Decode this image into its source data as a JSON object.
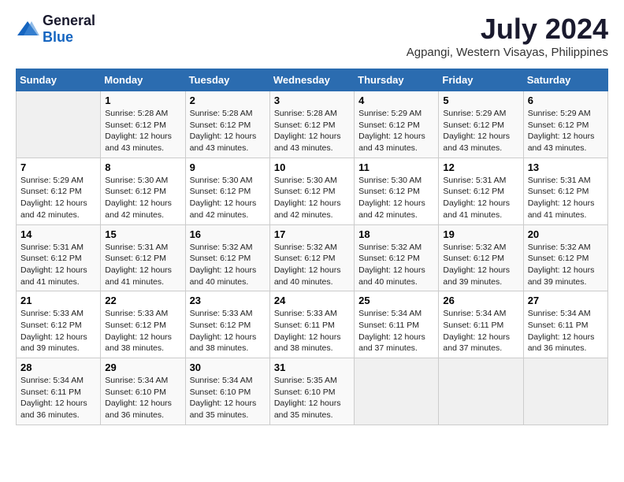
{
  "logo": {
    "general": "General",
    "blue": "Blue"
  },
  "title": "July 2024",
  "subtitle": "Agpangi, Western Visayas, Philippines",
  "days_header": [
    "Sunday",
    "Monday",
    "Tuesday",
    "Wednesday",
    "Thursday",
    "Friday",
    "Saturday"
  ],
  "weeks": [
    [
      {
        "num": "",
        "info": ""
      },
      {
        "num": "1",
        "info": "Sunrise: 5:28 AM\nSunset: 6:12 PM\nDaylight: 12 hours\nand 43 minutes."
      },
      {
        "num": "2",
        "info": "Sunrise: 5:28 AM\nSunset: 6:12 PM\nDaylight: 12 hours\nand 43 minutes."
      },
      {
        "num": "3",
        "info": "Sunrise: 5:28 AM\nSunset: 6:12 PM\nDaylight: 12 hours\nand 43 minutes."
      },
      {
        "num": "4",
        "info": "Sunrise: 5:29 AM\nSunset: 6:12 PM\nDaylight: 12 hours\nand 43 minutes."
      },
      {
        "num": "5",
        "info": "Sunrise: 5:29 AM\nSunset: 6:12 PM\nDaylight: 12 hours\nand 43 minutes."
      },
      {
        "num": "6",
        "info": "Sunrise: 5:29 AM\nSunset: 6:12 PM\nDaylight: 12 hours\nand 43 minutes."
      }
    ],
    [
      {
        "num": "7",
        "info": "Sunrise: 5:29 AM\nSunset: 6:12 PM\nDaylight: 12 hours\nand 42 minutes."
      },
      {
        "num": "8",
        "info": "Sunrise: 5:30 AM\nSunset: 6:12 PM\nDaylight: 12 hours\nand 42 minutes."
      },
      {
        "num": "9",
        "info": "Sunrise: 5:30 AM\nSunset: 6:12 PM\nDaylight: 12 hours\nand 42 minutes."
      },
      {
        "num": "10",
        "info": "Sunrise: 5:30 AM\nSunset: 6:12 PM\nDaylight: 12 hours\nand 42 minutes."
      },
      {
        "num": "11",
        "info": "Sunrise: 5:30 AM\nSunset: 6:12 PM\nDaylight: 12 hours\nand 42 minutes."
      },
      {
        "num": "12",
        "info": "Sunrise: 5:31 AM\nSunset: 6:12 PM\nDaylight: 12 hours\nand 41 minutes."
      },
      {
        "num": "13",
        "info": "Sunrise: 5:31 AM\nSunset: 6:12 PM\nDaylight: 12 hours\nand 41 minutes."
      }
    ],
    [
      {
        "num": "14",
        "info": "Sunrise: 5:31 AM\nSunset: 6:12 PM\nDaylight: 12 hours\nand 41 minutes."
      },
      {
        "num": "15",
        "info": "Sunrise: 5:31 AM\nSunset: 6:12 PM\nDaylight: 12 hours\nand 41 minutes."
      },
      {
        "num": "16",
        "info": "Sunrise: 5:32 AM\nSunset: 6:12 PM\nDaylight: 12 hours\nand 40 minutes."
      },
      {
        "num": "17",
        "info": "Sunrise: 5:32 AM\nSunset: 6:12 PM\nDaylight: 12 hours\nand 40 minutes."
      },
      {
        "num": "18",
        "info": "Sunrise: 5:32 AM\nSunset: 6:12 PM\nDaylight: 12 hours\nand 40 minutes."
      },
      {
        "num": "19",
        "info": "Sunrise: 5:32 AM\nSunset: 6:12 PM\nDaylight: 12 hours\nand 39 minutes."
      },
      {
        "num": "20",
        "info": "Sunrise: 5:32 AM\nSunset: 6:12 PM\nDaylight: 12 hours\nand 39 minutes."
      }
    ],
    [
      {
        "num": "21",
        "info": "Sunrise: 5:33 AM\nSunset: 6:12 PM\nDaylight: 12 hours\nand 39 minutes."
      },
      {
        "num": "22",
        "info": "Sunrise: 5:33 AM\nSunset: 6:12 PM\nDaylight: 12 hours\nand 38 minutes."
      },
      {
        "num": "23",
        "info": "Sunrise: 5:33 AM\nSunset: 6:12 PM\nDaylight: 12 hours\nand 38 minutes."
      },
      {
        "num": "24",
        "info": "Sunrise: 5:33 AM\nSunset: 6:11 PM\nDaylight: 12 hours\nand 38 minutes."
      },
      {
        "num": "25",
        "info": "Sunrise: 5:34 AM\nSunset: 6:11 PM\nDaylight: 12 hours\nand 37 minutes."
      },
      {
        "num": "26",
        "info": "Sunrise: 5:34 AM\nSunset: 6:11 PM\nDaylight: 12 hours\nand 37 minutes."
      },
      {
        "num": "27",
        "info": "Sunrise: 5:34 AM\nSunset: 6:11 PM\nDaylight: 12 hours\nand 36 minutes."
      }
    ],
    [
      {
        "num": "28",
        "info": "Sunrise: 5:34 AM\nSunset: 6:11 PM\nDaylight: 12 hours\nand 36 minutes."
      },
      {
        "num": "29",
        "info": "Sunrise: 5:34 AM\nSunset: 6:10 PM\nDaylight: 12 hours\nand 36 minutes."
      },
      {
        "num": "30",
        "info": "Sunrise: 5:34 AM\nSunset: 6:10 PM\nDaylight: 12 hours\nand 35 minutes."
      },
      {
        "num": "31",
        "info": "Sunrise: 5:35 AM\nSunset: 6:10 PM\nDaylight: 12 hours\nand 35 minutes."
      },
      {
        "num": "",
        "info": ""
      },
      {
        "num": "",
        "info": ""
      },
      {
        "num": "",
        "info": ""
      }
    ]
  ]
}
